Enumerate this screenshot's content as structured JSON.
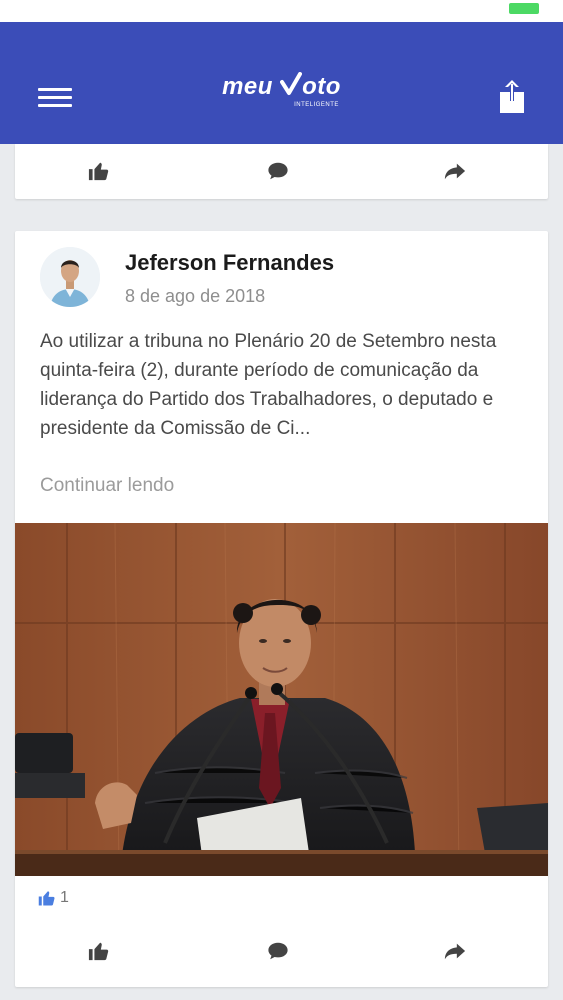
{
  "header": {
    "logo_text_a": "meu",
    "logo_text_b": "oto",
    "logo_sub": "INTELIGENTE",
    "brand_color": "#3b4db8",
    "menu_icon": "hamburger-menu-icon",
    "share_icon": "share-upload-icon"
  },
  "previous_post": {
    "actions": [
      "like-icon",
      "comment-icon",
      "share-icon"
    ]
  },
  "post": {
    "author": "Jeferson Fernandes",
    "date": "8 de ago de 2018",
    "text": "Ao utilizar a tribuna no Plenário 20 de Setembro nesta quinta-feira (2), durante período de comunicação da liderança do Partido dos Trabalhadores, o deputado e presidente da Comissão de Ci...",
    "read_more": "Continuar lendo",
    "likes_count": "1",
    "like_color": "#4a7ee0",
    "actions": [
      "like-icon",
      "comment-icon",
      "share-icon"
    ]
  }
}
